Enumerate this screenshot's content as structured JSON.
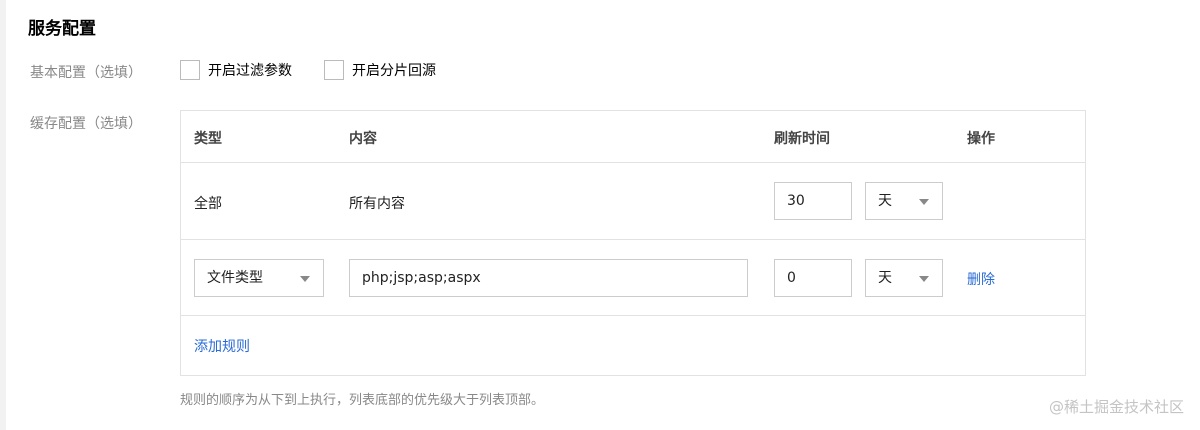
{
  "section": {
    "title": "服务配置"
  },
  "basic": {
    "label": "基本配置（选填）",
    "filter_param_label": "开启过滤参数",
    "range_origin_label": "开启分片回源"
  },
  "cache": {
    "label": "缓存配置（选填）",
    "headers": {
      "type": "类型",
      "content": "内容",
      "refresh": "刷新时间",
      "action": "操作"
    },
    "rows": [
      {
        "type": "全部",
        "content": "所有内容",
        "refresh_value": "30",
        "unit": "天"
      },
      {
        "type": "文件类型",
        "content": "php;jsp;asp;aspx",
        "refresh_value": "0",
        "unit": "天",
        "delete_label": "删除"
      }
    ],
    "add_rule_label": "添加规则"
  },
  "hint": "规则的顺序为从下到上执行，列表底部的优先级大于列表顶部。",
  "watermark": "@稀土掘金技术社区"
}
